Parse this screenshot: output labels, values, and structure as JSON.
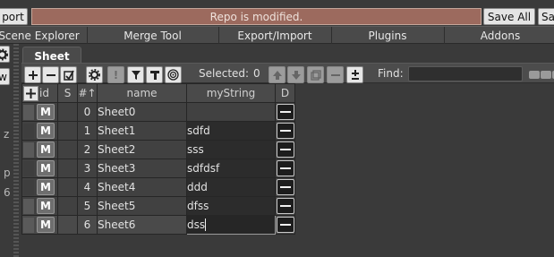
{
  "top": {
    "left_button": "port",
    "status": "Repo is modified.",
    "save_all": "Save All",
    "right_stub": "Sa"
  },
  "tabs": [
    "Scene Explorer",
    "Merge Tool",
    "Export/Import",
    "Plugins",
    "Addons"
  ],
  "side_stub": "w",
  "sheet_tab": "Sheet",
  "toolbar": {
    "selected_label": "Selected:",
    "selected_count": "0",
    "find_label": "Find:",
    "find_value": ""
  },
  "left_tags": {
    "row1": "z",
    "row3": "p",
    "row4": "6"
  },
  "grid": {
    "headers": {
      "id": "id",
      "s": "S",
      "num": "#↑",
      "name": "name",
      "mystring": "myString",
      "d": "D"
    },
    "m_label": "M",
    "rows": [
      {
        "index": "0",
        "name": "Sheet0",
        "mystring": ""
      },
      {
        "index": "1",
        "name": "Sheet1",
        "mystring": "sdfd"
      },
      {
        "index": "2",
        "name": "Sheet2",
        "mystring": "sss"
      },
      {
        "index": "3",
        "name": "Sheet3",
        "mystring": "sdfdsf"
      },
      {
        "index": "4",
        "name": "Sheet4",
        "mystring": "ddd"
      },
      {
        "index": "5",
        "name": "Sheet5",
        "mystring": "dfss"
      },
      {
        "index": "6",
        "name": "Sheet6",
        "mystring": "dss"
      }
    ]
  },
  "colors": {
    "status_bg": "#9c6a5e",
    "panel_bg": "#3a3a3a",
    "cell_bg": "#414141",
    "input_bg": "#2c2c2c"
  }
}
